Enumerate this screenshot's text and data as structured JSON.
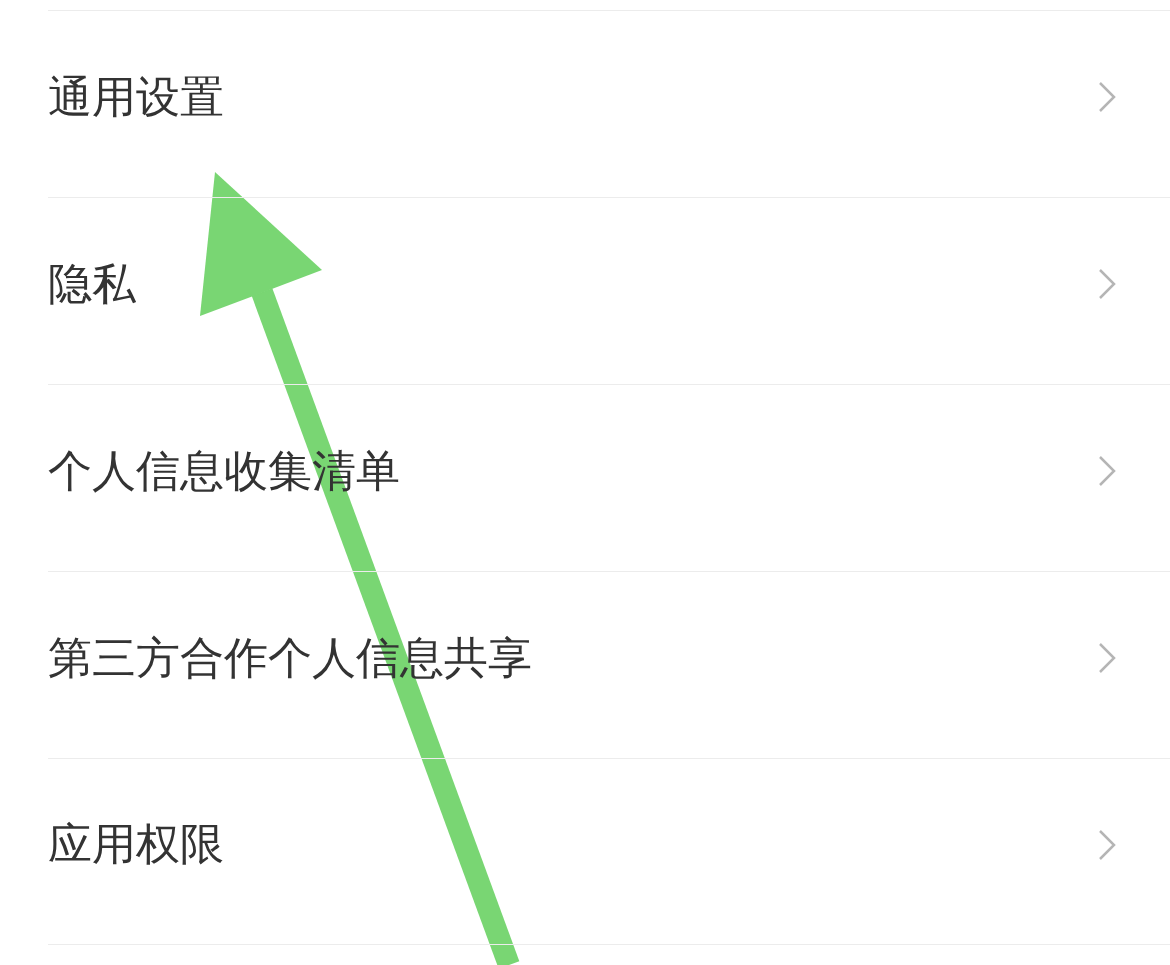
{
  "settings_list": [
    {
      "label": "通用设置"
    },
    {
      "label": "隐私"
    },
    {
      "label": "个人信息收集清单"
    },
    {
      "label": "第三方合作个人信息共享"
    },
    {
      "label": "应用权限"
    }
  ]
}
